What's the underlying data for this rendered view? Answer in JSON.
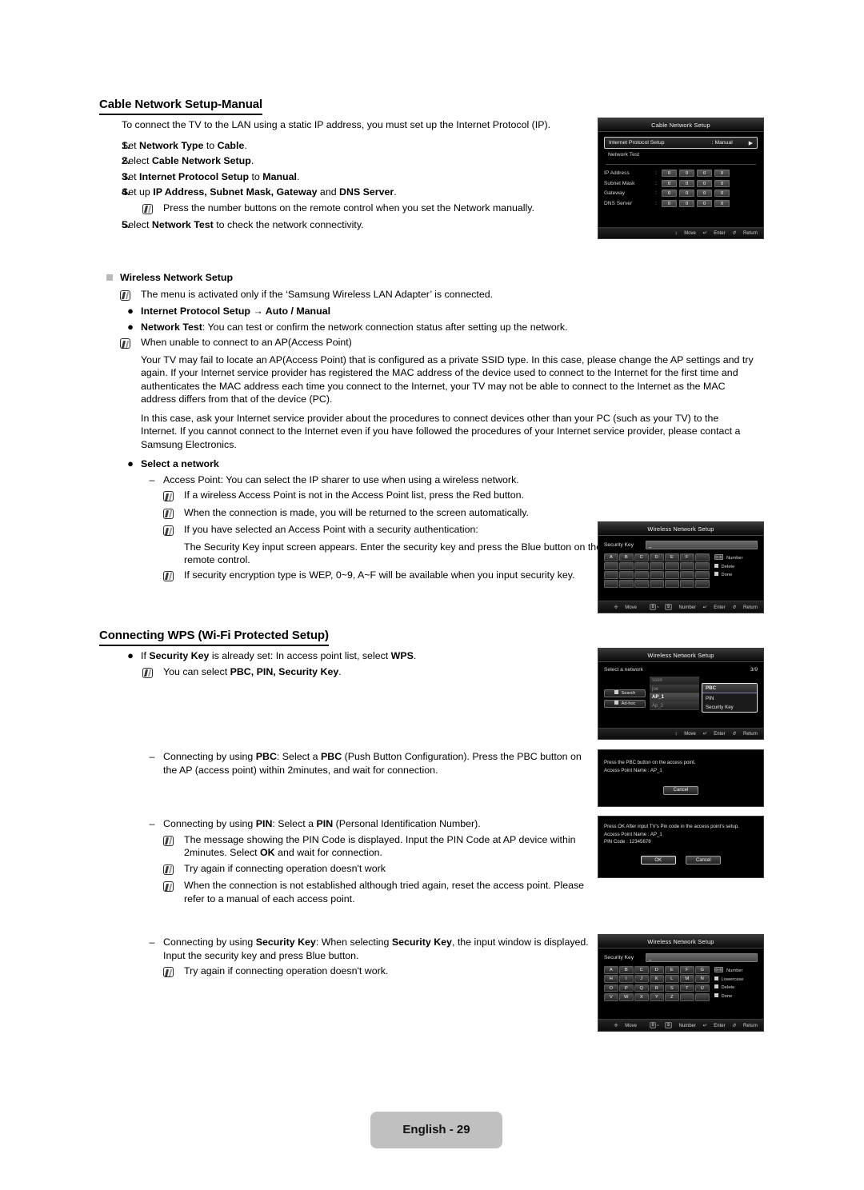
{
  "document": {
    "footer_label": "English - 29"
  },
  "section1": {
    "heading": "Cable Network Setup-Manual",
    "intro": "To connect the TV to the LAN using a static IP address, you must set up the Internet Protocol (IP).",
    "steps": [
      {
        "num": "1.",
        "html": "Set <b>Network Type</b> to <b>Cable</b>."
      },
      {
        "num": "2.",
        "html": "Select <b>Cable Network Setup</b>."
      },
      {
        "num": "3.",
        "html": "Set <b>Internet Protocol Setup</b> to <b>Manual</b>."
      },
      {
        "num": "4.",
        "html": "Set up <b>IP Address, Subnet Mask, Gateway</b> and <b>DNS Server</b>."
      },
      {
        "num": "5.",
        "html": "Select <b>Network Test</b> to check the network connectivity."
      }
    ],
    "step4_note": "Press the number buttons on the remote control when you set the Network manually."
  },
  "section2": {
    "heading": "Wireless Network Setup",
    "note1": "The menu is activated only if the ‘Samsung Wireless LAN Adapter’ is connected.",
    "bullet1_html": "<b>Internet Protocol Setup → Auto / Manual</b>",
    "bullet2_html": "<b>Network Test</b>: You can test or confirm the network connection status after setting up the network.",
    "note2": "When unable to connect to an AP(Access Point)",
    "para1": "Your TV may fail to locate an AP(Access Point) that is configured as a private SSID type. In this case, please change the AP settings and try again. If your Internet service provider has registered the MAC address of the device used to connect to the Internet for the first time and authenticates the MAC address each time you connect to the Internet, your TV may not be able to connect to the Internet as the MAC address differs from that of the device (PC).",
    "para2": "In this case, ask your Internet service provider about the procedures to connect devices other than your PC (such as your TV) to the Internet. If you cannot connect to the Internet even if you have followed the procedures of your Internet service provider, please contact a Samsung Electronics.",
    "bullet3_html": "<b>Select a network</b>",
    "dash1": "Access Point: You can select the IP sharer to use when using a wireless network.",
    "note3": "If a wireless Access Point is not in the Access Point list, press the Red button.",
    "note4": "When the connection is made, you will be returned to the screen automatically.",
    "note5": "If you have selected an Access Point with a security authentication:",
    "note5_cont": "The Security Key input screen appears. Enter the security key and press the Blue button on the remote control.",
    "note6": "If security encryption type is WEP, 0~9, A~F will be available when you input security key."
  },
  "section3": {
    "heading": "Connecting WPS (Wi-Fi Protected Setup)",
    "bullet1_html": "If <b>Security Key</b> is already set: In access point list, select <b>WPS</b>.",
    "note1_html": "You can select <b>PBC, PIN, Security Key</b>.",
    "dash_pbc_html": "Connecting by using <b>PBC</b>: Select a <b>PBC</b> (Push Button Configuration). Press the PBC button on the AP (access point) within 2minutes, and wait for connection.",
    "dash_pin_html": "Connecting by using <b>PIN</b>: Select a <b>PIN</b> (Personal Identification Number).",
    "pin_note1_html": "The message showing the PIN Code is displayed. Input the PIN Code at AP device within 2minutes. Select <b>OK</b> and wait for connection.",
    "pin_note2": "Try again if connecting operation doesn't work",
    "pin_note3": "When the connection is not established although tried again, reset the access point. Please refer to a manual of each access point.",
    "dash_key_html": "Connecting by using <b>Security Key</b>: When selecting <b>Security Key</b>, the input window is displayed. Input the security key and press Blue button.",
    "key_note1": "Try again if connecting operation doesn't work."
  },
  "osd_cable": {
    "title": "Cable Network Setup",
    "row_protocol_label": "Internet Protocol Setup",
    "row_protocol_value": ": Manual",
    "row_networktest": "Network Test",
    "fields": [
      {
        "label": "IP Address",
        "values": [
          "0",
          "0",
          "0",
          "0"
        ]
      },
      {
        "label": "Subnet Mask",
        "values": [
          "0",
          "0",
          "0",
          "0"
        ]
      },
      {
        "label": "Gateway",
        "values": [
          "0",
          "0",
          "0",
          "0"
        ]
      },
      {
        "label": "DNS Server",
        "values": [
          "0",
          "0",
          "0",
          "0"
        ]
      }
    ],
    "footer": {
      "move": "Move",
      "enter": "Enter",
      "return": "Return"
    }
  },
  "osd_seckey_hex": {
    "title": "Wireless Network Setup",
    "field_label": "Security Key",
    "field_value": "_",
    "keys": [
      "A",
      "B",
      "C",
      "D",
      "E",
      "F",
      "",
      "",
      "",
      "",
      "",
      "",
      "",
      "",
      "",
      "",
      "",
      "",
      "",
      "",
      "",
      "",
      "",
      "",
      "",
      "",
      "",
      ""
    ],
    "legend": [
      {
        "type": "num",
        "mark": "0~9",
        "label": "Number"
      },
      {
        "type": "sq",
        "label": "Delete"
      },
      {
        "type": "sq",
        "label": "Done"
      }
    ],
    "footer": {
      "move": "Move",
      "number": "Number",
      "number_range": "0 ~ 9",
      "enter": "Enter",
      "return": "Return"
    }
  },
  "osd_select_network": {
    "title": "Wireless Network Setup",
    "label": "Select a network",
    "counter": "3/9",
    "buttons": [
      "Search",
      "Ad-hoc"
    ],
    "networks": [
      "sson",
      "joe",
      "AP_1",
      "Ap_2"
    ],
    "selected_network": "AP_1",
    "dropdown": [
      "PBC",
      "PIN",
      "Security Key"
    ],
    "dropdown_selected": "PBC",
    "footer": {
      "move": "Move",
      "enter": "Enter",
      "return": "Return"
    }
  },
  "osd_pbc_dialog": {
    "line1": "Press the PBC button on the access point.",
    "line2": "Access Point Name : AP_1",
    "buttons": [
      "Cancel"
    ]
  },
  "osd_pin_dialog": {
    "line1": "Press OK After input TV's Pin code in the access point's setup.",
    "line2": "Access Point Name : AP_1",
    "line3": "PIN Code : 12345678",
    "buttons": [
      "OK",
      "Cancel"
    ]
  },
  "osd_seckey_full": {
    "title": "Wireless Network Setup",
    "field_label": "Security Key",
    "field_value": "_",
    "keys": [
      "A",
      "B",
      "C",
      "D",
      "E",
      "F",
      "G",
      "H",
      "I",
      "J",
      "K",
      "L",
      "M",
      "N",
      "O",
      "P",
      "Q",
      "R",
      "S",
      "T",
      "U",
      "V",
      "W",
      "X",
      "Y",
      "Z",
      "",
      ""
    ],
    "legend": [
      {
        "type": "num",
        "mark": "0~9",
        "label": "Number"
      },
      {
        "type": "sq",
        "label": "Lowercase"
      },
      {
        "type": "sq",
        "label": "Delete"
      },
      {
        "type": "sq",
        "label": "Done"
      }
    ],
    "footer": {
      "move": "Move",
      "number": "Number",
      "number_range": "0 ~ 9",
      "enter": "Enter",
      "return": "Return"
    }
  }
}
